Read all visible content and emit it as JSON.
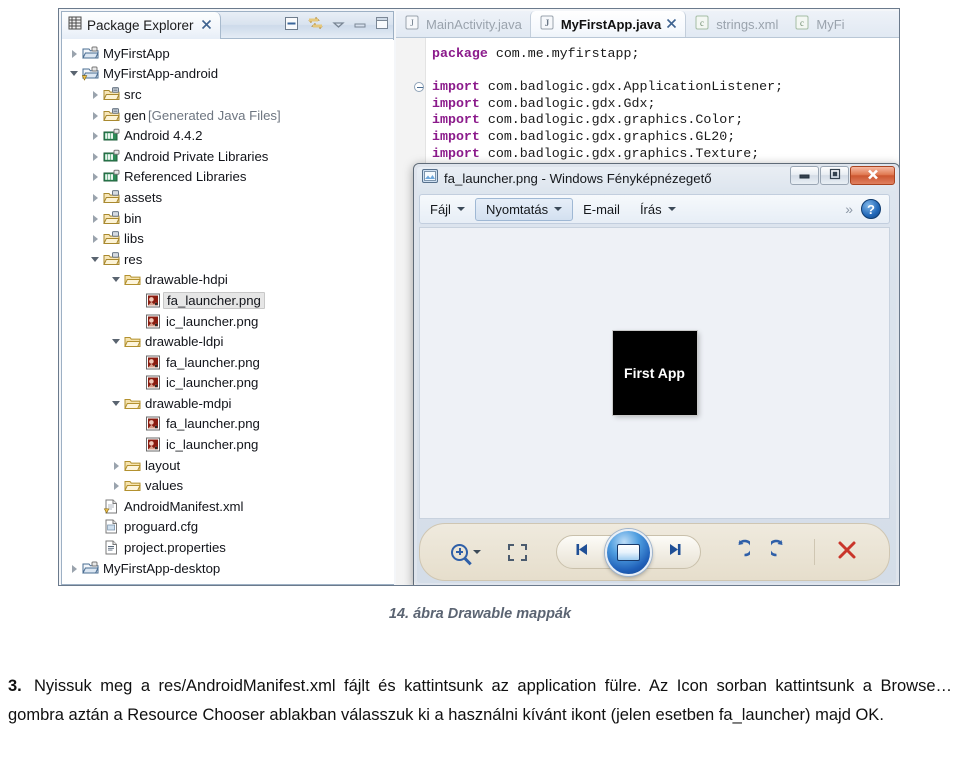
{
  "figure": {
    "caption": "14. ábra Drawable mappák"
  },
  "eclipse": {
    "package_explorer": {
      "tab_label": "Package Explorer",
      "tab_close": "⌧",
      "toolbar": [
        {
          "name": "collapse-all-icon",
          "title": "Collapse All"
        },
        {
          "name": "link-with-editor-icon",
          "title": "Link with Editor"
        },
        {
          "name": "view-menu-icon",
          "title": "View Menu"
        },
        {
          "name": "minimize-icon",
          "title": "Minimize"
        },
        {
          "name": "maximize-icon",
          "title": "Maximize"
        }
      ],
      "tree": [
        {
          "label": "MyFirstApp",
          "indent": 0,
          "arrow": "closed",
          "icon": "project-icon",
          "selected": false
        },
        {
          "label": "MyFirstApp-android",
          "indent": 0,
          "arrow": "open",
          "icon": "project-warning-icon",
          "selected": false
        },
        {
          "label": "src",
          "indent": 1,
          "arrow": "closed",
          "icon": "source-folder-icon",
          "selected": false
        },
        {
          "label": "gen",
          "suffix": " [Generated Java Files]",
          "indent": 1,
          "arrow": "closed",
          "icon": "source-folder-icon",
          "selected": false
        },
        {
          "label": "Android 4.4.2",
          "indent": 1,
          "arrow": "closed",
          "icon": "library-icon",
          "selected": false
        },
        {
          "label": "Android Private Libraries",
          "indent": 1,
          "arrow": "closed",
          "icon": "library-icon",
          "selected": false
        },
        {
          "label": "Referenced Libraries",
          "indent": 1,
          "arrow": "closed",
          "icon": "library-icon",
          "selected": false
        },
        {
          "label": "assets",
          "indent": 1,
          "arrow": "closed",
          "icon": "folder-res-icon",
          "selected": false
        },
        {
          "label": "bin",
          "indent": 1,
          "arrow": "closed",
          "icon": "folder-res-icon",
          "selected": false
        },
        {
          "label": "libs",
          "indent": 1,
          "arrow": "closed",
          "icon": "folder-res-icon",
          "selected": false
        },
        {
          "label": "res",
          "indent": 1,
          "arrow": "open",
          "icon": "folder-res-icon",
          "selected": false
        },
        {
          "label": "drawable-hdpi",
          "indent": 2,
          "arrow": "open",
          "icon": "folder-icon",
          "selected": false
        },
        {
          "label": "fa_launcher.png",
          "indent": 3,
          "arrow": "none",
          "icon": "image-file-icon",
          "selected": true
        },
        {
          "label": "ic_launcher.png",
          "indent": 3,
          "arrow": "none",
          "icon": "image-file-icon",
          "selected": false
        },
        {
          "label": "drawable-ldpi",
          "indent": 2,
          "arrow": "open",
          "icon": "folder-icon",
          "selected": false
        },
        {
          "label": "fa_launcher.png",
          "indent": 3,
          "arrow": "none",
          "icon": "image-file-icon",
          "selected": false
        },
        {
          "label": "ic_launcher.png",
          "indent": 3,
          "arrow": "none",
          "icon": "image-file-icon",
          "selected": false
        },
        {
          "label": "drawable-mdpi",
          "indent": 2,
          "arrow": "open",
          "icon": "folder-icon",
          "selected": false
        },
        {
          "label": "fa_launcher.png",
          "indent": 3,
          "arrow": "none",
          "icon": "image-file-icon",
          "selected": false
        },
        {
          "label": "ic_launcher.png",
          "indent": 3,
          "arrow": "none",
          "icon": "image-file-icon",
          "selected": false
        },
        {
          "label": "layout",
          "indent": 2,
          "arrow": "closed",
          "icon": "folder-icon",
          "selected": false
        },
        {
          "label": "values",
          "indent": 2,
          "arrow": "closed",
          "icon": "folder-icon",
          "selected": false
        },
        {
          "label": "AndroidManifest.xml",
          "indent": 1,
          "arrow": "none",
          "icon": "xml-warning-file-icon",
          "selected": false
        },
        {
          "label": "proguard.cfg",
          "indent": 1,
          "arrow": "none",
          "icon": "cfg-file-icon",
          "selected": false
        },
        {
          "label": "project.properties",
          "indent": 1,
          "arrow": "none",
          "icon": "properties-file-icon",
          "selected": false
        },
        {
          "label": "MyFirstApp-desktop",
          "indent": 0,
          "arrow": "closed",
          "icon": "project-icon",
          "selected": false
        }
      ]
    },
    "editor": {
      "tabs": [
        {
          "label": "MainActivity.java",
          "icon": "java-file-icon",
          "active": false
        },
        {
          "label": "MyFirstApp.java",
          "icon": "java-file-icon",
          "active": true,
          "close": "⌧"
        },
        {
          "label": "strings.xml",
          "icon": "xml-file-icon",
          "active": false
        },
        {
          "label": "MyFi",
          "icon": "xml-file-icon",
          "active": false
        }
      ],
      "code_lines": [
        {
          "keyword": "package",
          "rest": " com.me.myfirstapp;",
          "fold": false
        },
        {
          "keyword": "",
          "rest": "",
          "fold": false
        },
        {
          "keyword": "import",
          "rest": " com.badlogic.gdx.ApplicationListener;",
          "fold": true
        },
        {
          "keyword": "import",
          "rest": " com.badlogic.gdx.Gdx;",
          "fold": false
        },
        {
          "keyword": "import",
          "rest": " com.badlogic.gdx.graphics.Color;",
          "fold": false
        },
        {
          "keyword": "import",
          "rest": " com.badlogic.gdx.graphics.GL20;",
          "fold": false
        },
        {
          "keyword": "import",
          "rest": " com.badlogic.gdx.graphics.Texture;",
          "fold": false
        }
      ]
    }
  },
  "photo_viewer": {
    "title": "fa_launcher.png - Windows Fényképnézegető",
    "title_icon": "photo-viewer-icon",
    "window_buttons": [
      {
        "name": "minimize-button",
        "glyph": "–"
      },
      {
        "name": "restore-button",
        "glyph": "▣"
      },
      {
        "name": "close-button",
        "glyph": "✕"
      }
    ],
    "toolbar": [
      {
        "label": "Fájl",
        "caret": true,
        "pressed": false
      },
      {
        "label": "Nyomtatás",
        "caret": true,
        "pressed": true
      },
      {
        "label": "E-mail",
        "caret": false,
        "pressed": false
      },
      {
        "label": "Írás",
        "caret": true,
        "pressed": false
      }
    ],
    "overflow_glyph": "»",
    "help_glyph": "?",
    "image_text": "First App",
    "bottom_toolbar": [
      {
        "name": "zoom-button",
        "glyph": ""
      },
      {
        "name": "fit-to-window-button",
        "glyph": ""
      },
      {
        "name": "previous-button",
        "glyph": "◀❙"
      },
      {
        "name": "slideshow-button",
        "glyph": ""
      },
      {
        "name": "next-button",
        "glyph": "❙▶"
      },
      {
        "name": "rotate-left-button",
        "glyph": "↺"
      },
      {
        "name": "rotate-right-button",
        "glyph": "↻"
      },
      {
        "name": "delete-button",
        "glyph": "✕"
      }
    ],
    "colors": {
      "delete": "#c9352a",
      "rotate": "#2f5fa8",
      "close_bar": "#cc5630"
    }
  },
  "document": {
    "step_number": "3.",
    "paragraph_1": "Nyissuk meg a res/AndroidManifest.xml fájlt és kattintsunk az application fülre. Az Icon sorban kattintsunk a Browse… gombra aztán a Resource Chooser ablakban válasszuk ki a használni kívánt ikont (jelen esetben fa_launcher) majd OK."
  }
}
